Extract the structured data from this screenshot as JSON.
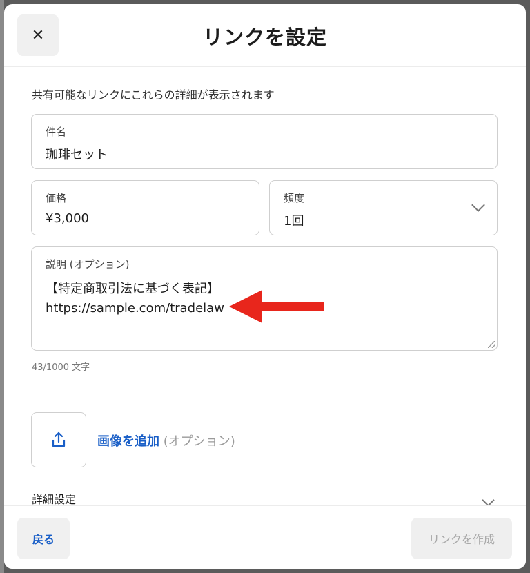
{
  "header": {
    "close_icon": "✕",
    "title": "リンクを設定"
  },
  "subtitle": "共有可能なリンクにこれらの詳細が表示されます",
  "fields": {
    "name": {
      "label": "件名",
      "value": "珈琲セット"
    },
    "price": {
      "label": "価格",
      "value": "¥3,000"
    },
    "frequency": {
      "label": "頻度",
      "value": "1回"
    },
    "description": {
      "label": "説明 (オプション)",
      "line1": "【特定商取引法に基づく表記】",
      "line2": "https://sample.com/tradelaw"
    }
  },
  "char_count": "43/1000 文字",
  "image": {
    "add_label": "画像を追加",
    "optional": "(オプション)",
    "icon": "upload-icon"
  },
  "advanced_settings": "詳細設定",
  "footer": {
    "back_label": "戻る",
    "create_label": "リンクを作成"
  },
  "colors": {
    "accent": "#1a5fc7",
    "annotation_arrow": "#e8261c"
  }
}
